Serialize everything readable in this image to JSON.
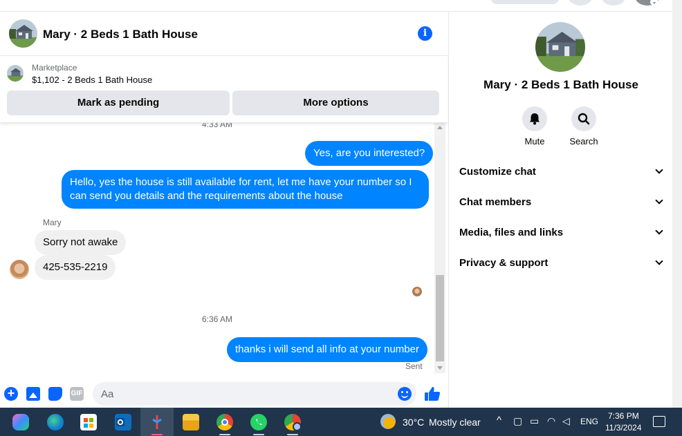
{
  "chat": {
    "title": "Mary · 2 Beds 1 Bath House"
  },
  "marketplace": {
    "label": "Marketplace",
    "listing": "$1,102 - 2 Beds 1 Bath House",
    "mark_pending_label": "Mark as pending",
    "more_options_label": "More options"
  },
  "messages": {
    "top_timestamp": "4:33 AM",
    "items": [
      {
        "direction": "out",
        "text": "Yes, are you interested?"
      },
      {
        "direction": "out",
        "text": "Hello, yes the house is still available for rent, let me have your number so I can send you details and the requirements about the house"
      },
      {
        "direction": "in",
        "sender": "Mary",
        "text": "Sorry not awake"
      },
      {
        "direction": "in",
        "text": "425-535-2219"
      },
      {
        "direction": "out",
        "text": "thanks i will send all info at your number"
      }
    ],
    "middle_timestamp": "6:36 AM",
    "sent_status": "Sent"
  },
  "composer": {
    "placeholder": "Aa",
    "gif_label": "GIF"
  },
  "panel": {
    "title": "Mary · 2 Beds 1 Bath House",
    "actions": [
      {
        "label": "Mute",
        "icon": "bell-icon"
      },
      {
        "label": "Search",
        "icon": "search-icon"
      }
    ],
    "sections": [
      {
        "label": "Customize chat"
      },
      {
        "label": "Chat members"
      },
      {
        "label": "Media, files and links"
      },
      {
        "label": "Privacy & support"
      }
    ]
  },
  "taskbar": {
    "weather_temp": "30°C",
    "weather_desc": "Mostly clear",
    "language": "ENG",
    "time": "7:36 PM",
    "date": "11/3/2024",
    "apps": [
      "copilot-icon",
      "edge-icon",
      "store-icon",
      "outlook-icon",
      "app-icon",
      "file-explorer-icon",
      "chrome-icon",
      "whatsapp-icon",
      "chrome-profile-icon"
    ]
  },
  "colors": {
    "messenger_blue": "#0084ff",
    "accent": "#0866ff",
    "taskbar": "#20344b"
  }
}
